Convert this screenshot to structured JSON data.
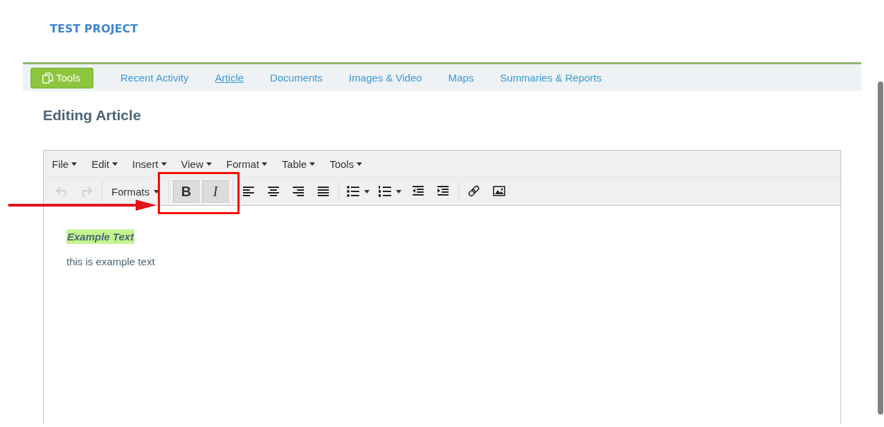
{
  "project_title": "TEST PROJECT",
  "nav": [
    {
      "label": "Tools",
      "kind": "button",
      "selected": false
    },
    {
      "label": "Recent Activity",
      "kind": "link",
      "selected": false
    },
    {
      "label": "Article",
      "kind": "link",
      "selected": true
    },
    {
      "label": "Documents",
      "kind": "link",
      "selected": false
    },
    {
      "label": "Images & Video",
      "kind": "link",
      "selected": false
    },
    {
      "label": "Maps",
      "kind": "link",
      "selected": false
    },
    {
      "label": "Summaries & Reports",
      "kind": "link",
      "selected": false
    }
  ],
  "heading": "Editing Article",
  "editor": {
    "menus": [
      "File",
      "Edit",
      "Insert",
      "View",
      "Format",
      "Table",
      "Tools"
    ],
    "toolbar": [
      [
        {
          "kind": "undo",
          "disabled": true
        },
        {
          "kind": "redo",
          "disabled": true
        }
      ],
      [
        {
          "kind": "formats",
          "label": "Formats",
          "disabled": false
        }
      ],
      [
        {
          "kind": "text",
          "label": "B",
          "pressed": true,
          "disabled": false
        },
        {
          "kind": "italic",
          "label": "I",
          "pressed": true,
          "disabled": false
        }
      ],
      [
        {
          "kind": "align-left",
          "disabled": false
        },
        {
          "kind": "align-center",
          "disabled": false
        },
        {
          "kind": "align-right",
          "disabled": false
        },
        {
          "kind": "justify",
          "disabled": false
        }
      ],
      [
        {
          "kind": "bullets",
          "disabled": false
        },
        {
          "kind": "numbers",
          "disabled": false
        },
        {
          "kind": "outdent",
          "disabled": false
        },
        {
          "kind": "indent",
          "disabled": false
        }
      ],
      [
        {
          "kind": "link",
          "disabled": false
        },
        {
          "kind": "image",
          "disabled": false
        }
      ]
    ],
    "content": [
      {
        "kind": "highlight",
        "text": "Example Text"
      },
      {
        "kind": "paragraph",
        "text": "this is example text"
      }
    ]
  },
  "annotation_arrow": true,
  "annotation_frame": true
}
